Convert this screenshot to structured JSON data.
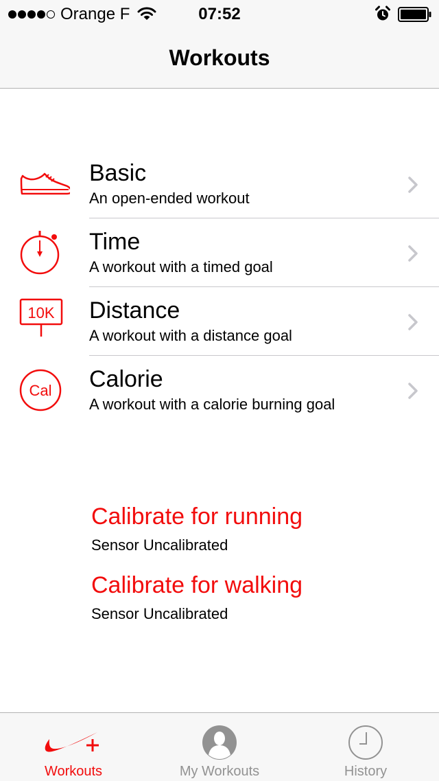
{
  "status_bar": {
    "carrier": "Orange F",
    "time": "07:52",
    "signal_bars_filled": 4,
    "signal_bars_total": 5,
    "icons": [
      "wifi-icon",
      "alarm-icon",
      "battery-icon"
    ]
  },
  "nav": {
    "title": "Workouts"
  },
  "workouts": [
    {
      "title": "Basic",
      "subtitle": "An open-ended workout",
      "icon": "shoe-icon"
    },
    {
      "title": "Time",
      "subtitle": "A workout with a timed goal",
      "icon": "stopwatch-icon"
    },
    {
      "title": "Distance",
      "subtitle": "A workout with a distance goal",
      "icon": "distance-sign-icon",
      "icon_text": "10K"
    },
    {
      "title": "Calorie",
      "subtitle": "A workout with a calorie burning goal",
      "icon": "calorie-icon",
      "icon_text": "Cal"
    }
  ],
  "calibration": [
    {
      "title": "Calibrate for running",
      "status": "Sensor Uncalibrated"
    },
    {
      "title": "Calibrate for walking",
      "status": "Sensor Uncalibrated"
    }
  ],
  "tabs": [
    {
      "label": "Workouts",
      "icon": "nike-swoosh-plus-icon",
      "active": true
    },
    {
      "label": "My Workouts",
      "icon": "profile-icon",
      "active": false
    },
    {
      "label": "History",
      "icon": "clock-icon",
      "active": false
    }
  ],
  "colors": {
    "accent": "#f20c0c",
    "bar_background": "#f7f7f7",
    "inactive_tab": "#929292",
    "separator": "#c8c7cc",
    "chevron": "#c7c7cc"
  }
}
